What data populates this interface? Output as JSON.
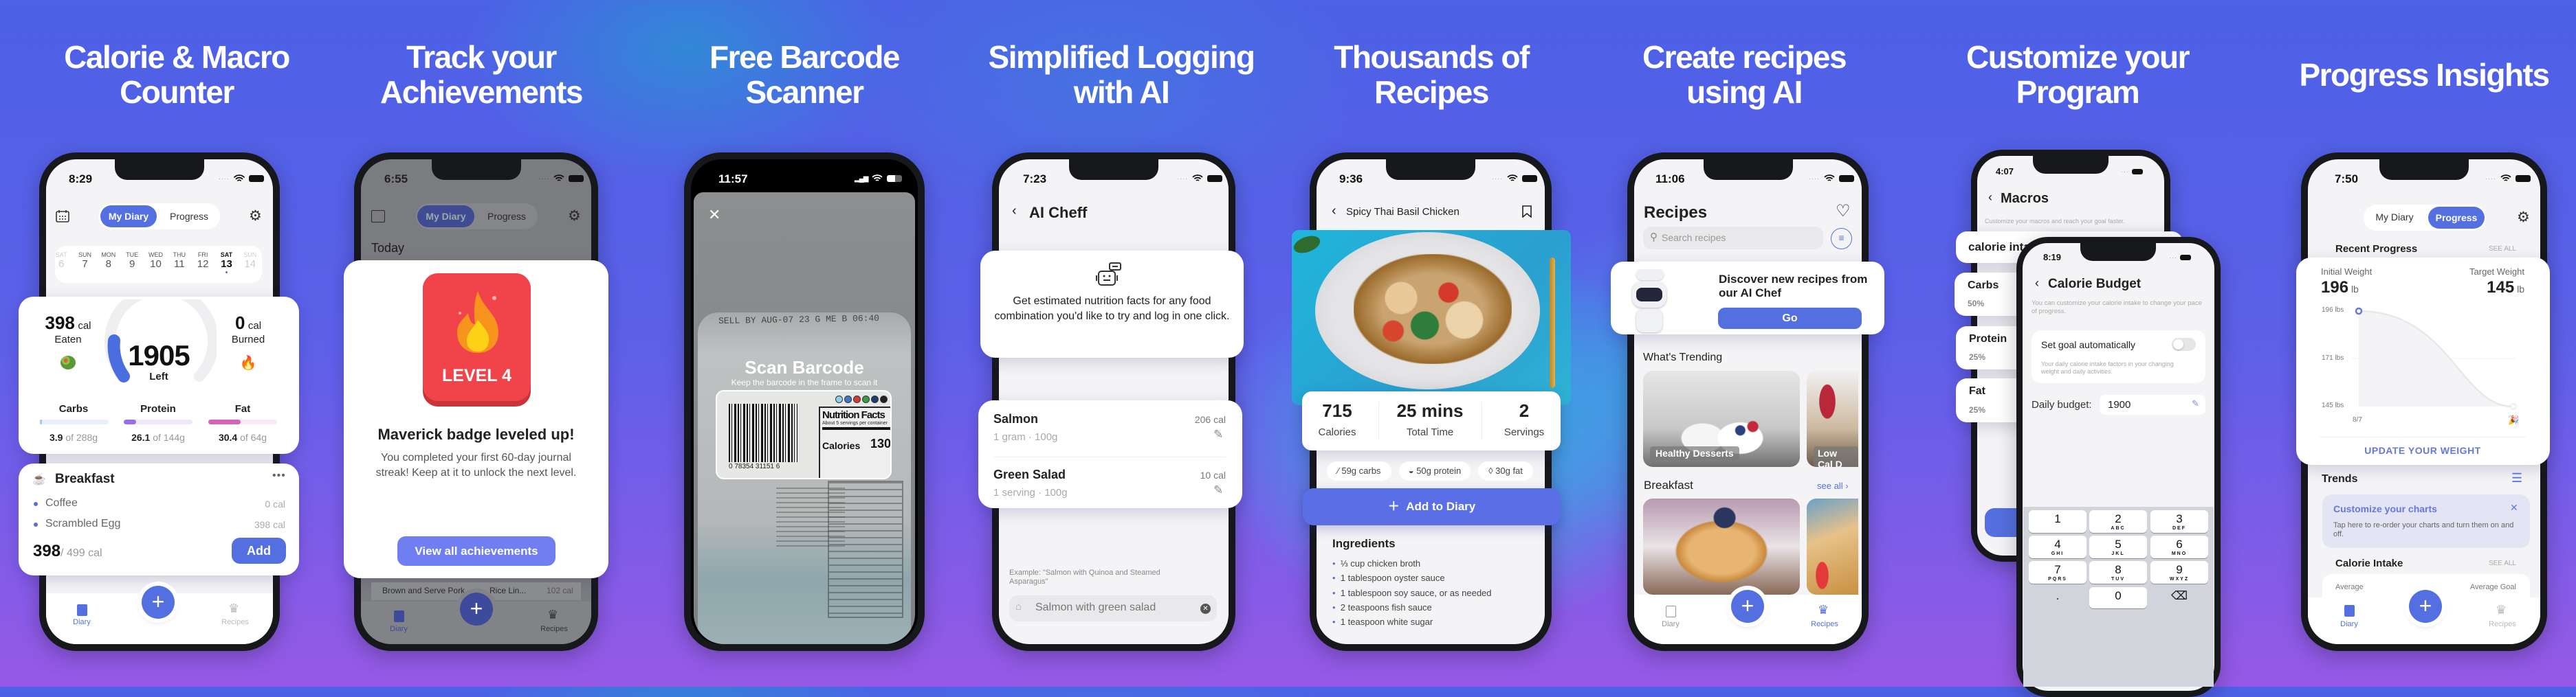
{
  "colors": {
    "accent": "#5470e0",
    "badge_red": "#f0444a",
    "tip_bg": "#e3e5f5"
  },
  "p1": {
    "headline": [
      "Calorie & Macro",
      "Counter"
    ],
    "time": "8:29",
    "seg": [
      "My Diary",
      "Progress"
    ],
    "week": [
      {
        "d": "SAT",
        "n": "6"
      },
      {
        "d": "SUN",
        "n": "7"
      },
      {
        "d": "MON",
        "n": "8"
      },
      {
        "d": "TUE",
        "n": "9"
      },
      {
        "d": "WED",
        "n": "10"
      },
      {
        "d": "THU",
        "n": "11"
      },
      {
        "d": "FRI",
        "n": "12"
      },
      {
        "d": "SAT",
        "n": "13"
      },
      {
        "d": "SUN",
        "n": "14"
      }
    ],
    "eaten": {
      "value": "398",
      "unit": "cal",
      "label": "Eaten"
    },
    "left": {
      "value": "1905",
      "label": "Left"
    },
    "burned": {
      "value": "0",
      "unit": "cal",
      "label": "Burned"
    },
    "macros": [
      {
        "name": "Carbs",
        "value": "3.9",
        "of": "of 288g",
        "fill": 0.014
      },
      {
        "name": "Protein",
        "value": "26.1",
        "of": "of 144g",
        "fill": 0.18
      },
      {
        "name": "Fat",
        "value": "30.4",
        "of": "of 64g",
        "fill": 0.47
      }
    ],
    "meal": {
      "title": "Breakfast",
      "items": [
        {
          "name": "Coffee",
          "cal": "0 cal"
        },
        {
          "name": "Scrambled Egg",
          "cal": "398 cal"
        }
      ],
      "total": "398",
      "goal": "/ 499 cal",
      "add": "Add"
    },
    "tabs": [
      "Diary",
      "Recipes"
    ]
  },
  "p2": {
    "headline": [
      "Track your",
      "Achievements"
    ],
    "time": "6:55",
    "seg": [
      "My Diary",
      "Progress"
    ],
    "today": "Today",
    "badge": "LEVEL 4",
    "title": "Maverick badge leveled up!",
    "body": "You completed your first 60-day journal streak! Keep at it to unlock the next level.",
    "button": "View all achievements",
    "row": {
      "a": "Brown and Serve Pork",
      "b": "Rice Lin...",
      "cal": "102 cal"
    },
    "tabs": [
      "Diary",
      "Recipes"
    ]
  },
  "p3": {
    "headline": [
      "Free Barcode",
      "Scanner"
    ],
    "time": "11:57",
    "title": "Scan Barcode",
    "hint": "Keep the barcode in the frame to scan it",
    "photo": {
      "sell_by": "SELL BY AUG-07 23 G ME B 06:40",
      "digits": "0  78354  31151  6",
      "nf": "Nutrition Facts",
      "servings": "About 5 servings per container",
      "calories": "Calories",
      "cal_value": "130"
    }
  },
  "p4": {
    "headline": [
      "Simplified Logging",
      "with AI"
    ],
    "time": "7:23",
    "title": "AI Cheff",
    "intro": "Get estimated nutrition facts for any food combination you'd like to try and log in one click.",
    "items": [
      {
        "name": "Salmon",
        "cal": "206 cal",
        "sub": "1 gram · 100g"
      },
      {
        "name": "Green Salad",
        "cal": "10 cal",
        "sub": "1 serving · 100g"
      }
    ],
    "example": "Example: \"Salmon with Quinoa and Steamed Asparagus\"",
    "input": "Salmon with green salad"
  },
  "p5": {
    "headline": [
      "Thousands of",
      "Recipes"
    ],
    "time": "9:36",
    "title": "Spicy Thai Basil Chicken",
    "stats": [
      {
        "v": "715",
        "l": "Calories"
      },
      {
        "v": "25 mins",
        "l": "Total Time"
      },
      {
        "v": "2",
        "l": "Servings"
      }
    ],
    "chips": [
      "59g carbs",
      "50g protein",
      "30g fat"
    ],
    "button": "Add to Diary",
    "ingredients_title": "Ingredients",
    "ingredients": [
      "⅓ cup chicken broth",
      "1 tablespoon oyster sauce",
      "1 tablespoon soy sauce, or as needed",
      "2 teaspoons fish sauce",
      "1 teaspoon white sugar"
    ]
  },
  "p6": {
    "headline": [
      "Create recipes",
      "using AI"
    ],
    "time": "11:06",
    "title": "Recipes",
    "search_placeholder": "Search recipes",
    "promo": "Discover new recipes from our AI Chef",
    "go": "Go",
    "trending": "What's Trending",
    "trend_items": [
      "Healthy Desserts",
      "Low Cal D"
    ],
    "breakfast": "Breakfast",
    "see_all": "see all",
    "tabs": [
      "Diary",
      "Recipes"
    ]
  },
  "p7": {
    "headline": [
      "Customize your",
      "Program"
    ],
    "back": {
      "time": "4:07",
      "title": "Macros",
      "sub": "Customize your macros and reach your goal faster.",
      "intake": "calorie intake",
      "rows": [
        {
          "n": "Carbs",
          "p": "50%"
        },
        {
          "n": "Protein",
          "p": "25%"
        },
        {
          "n": "Fat",
          "p": "25%"
        }
      ]
    },
    "front": {
      "time": "8:19",
      "title": "Calorie Budget",
      "sub": "You can customize your calorie intake to change your pace of progress.",
      "auto": "Set goal automatically",
      "auto_on": false,
      "auto_desc": "Your daily calorie intake factors in your changing weight and daily activities.",
      "budget_label": "Daily budget:",
      "budget": "1900",
      "keys": [
        {
          "d": "1",
          "l": ""
        },
        {
          "d": "2",
          "l": "ABC"
        },
        {
          "d": "3",
          "l": "DEF"
        },
        {
          "d": "4",
          "l": "GHI"
        },
        {
          "d": "5",
          "l": "JKL"
        },
        {
          "d": "6",
          "l": "MNO"
        },
        {
          "d": "7",
          "l": "PQRS"
        },
        {
          "d": "8",
          "l": "TUV"
        },
        {
          "d": "9",
          "l": "WXYZ"
        },
        {
          "d": ".",
          "l": ""
        },
        {
          "d": "0",
          "l": ""
        },
        {
          "d": "⌫",
          "l": ""
        }
      ]
    }
  },
  "p8": {
    "headline": [
      "Progress Insights"
    ],
    "time": "7:50",
    "seg": [
      "My Diary",
      "Progress"
    ],
    "recent": "Recent Progress",
    "see_all": "SEE ALL",
    "initial": {
      "label": "Initial Weight",
      "value": "196",
      "unit": "lb"
    },
    "target": {
      "label": "Target Weight",
      "value": "145",
      "unit": "lb"
    },
    "axis": [
      "196 lbs",
      "171 lbs",
      "145 lbs"
    ],
    "date": "8/7",
    "update": "UPDATE YOUR WEIGHT",
    "trends": "Trends",
    "tip": {
      "title": "Customize your charts",
      "body": "Tap here to re-order your charts and turn them on and off."
    },
    "intake": "Calorie Intake",
    "avg": "Average",
    "avg_goal": "Average Goal",
    "tabs": [
      "Diary",
      "Recipes"
    ]
  }
}
